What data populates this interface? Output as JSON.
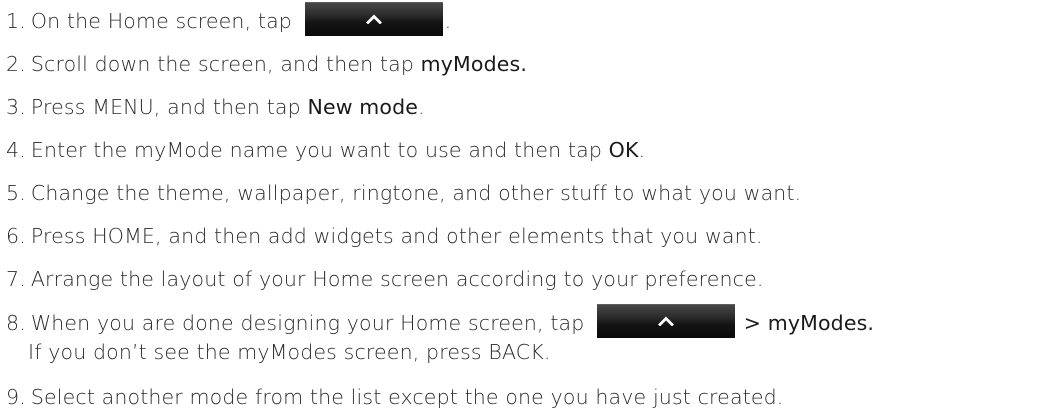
{
  "steps": [
    {
      "num": "1.",
      "pre": "On the Home screen, tap",
      "post": "."
    },
    {
      "num": "2.",
      "pre": "Scroll down the screen, and then tap ",
      "bold": "myModes."
    },
    {
      "num": "3.",
      "pre": "Press MENU, and then tap ",
      "bold": "New mode",
      "post": "."
    },
    {
      "num": "4.",
      "pre": "Enter the myMode name you want to use and then tap ",
      "bold": "OK",
      "post": "."
    },
    {
      "num": "5.",
      "pre": "Change the theme, wallpaper, ringtone, and other stuff to what you want."
    },
    {
      "num": "6.",
      "pre": "Press HOME, and then add widgets and other elements that you want."
    },
    {
      "num": "7.",
      "pre": "Arrange the layout of your Home screen according to your preference."
    },
    {
      "num": "8.",
      "pre": "When you are done designing your Home screen, tap",
      "post": "> myModes.",
      "cont": "If you don’t see the myModes screen, press BACK."
    },
    {
      "num": "9.",
      "pre": "Select another mode from the list except the one you have just created."
    }
  ],
  "icons": {
    "up_button": "chevron-up-icon",
    "colors": {
      "button_bg": "#1c1c1c",
      "chevron": "#ffffff",
      "text": "#2a2a2a"
    }
  }
}
